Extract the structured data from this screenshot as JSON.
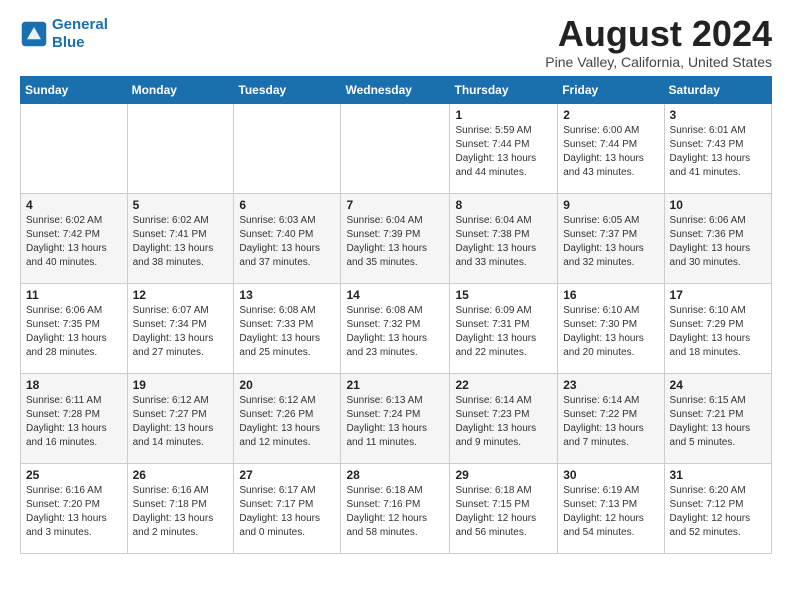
{
  "header": {
    "logo_line1": "General",
    "logo_line2": "Blue",
    "month_year": "August 2024",
    "location": "Pine Valley, California, United States"
  },
  "days_of_week": [
    "Sunday",
    "Monday",
    "Tuesday",
    "Wednesday",
    "Thursday",
    "Friday",
    "Saturday"
  ],
  "weeks": [
    [
      {
        "day": "",
        "info": ""
      },
      {
        "day": "",
        "info": ""
      },
      {
        "day": "",
        "info": ""
      },
      {
        "day": "",
        "info": ""
      },
      {
        "day": "1",
        "info": "Sunrise: 5:59 AM\nSunset: 7:44 PM\nDaylight: 13 hours\nand 44 minutes."
      },
      {
        "day": "2",
        "info": "Sunrise: 6:00 AM\nSunset: 7:44 PM\nDaylight: 13 hours\nand 43 minutes."
      },
      {
        "day": "3",
        "info": "Sunrise: 6:01 AM\nSunset: 7:43 PM\nDaylight: 13 hours\nand 41 minutes."
      }
    ],
    [
      {
        "day": "4",
        "info": "Sunrise: 6:02 AM\nSunset: 7:42 PM\nDaylight: 13 hours\nand 40 minutes."
      },
      {
        "day": "5",
        "info": "Sunrise: 6:02 AM\nSunset: 7:41 PM\nDaylight: 13 hours\nand 38 minutes."
      },
      {
        "day": "6",
        "info": "Sunrise: 6:03 AM\nSunset: 7:40 PM\nDaylight: 13 hours\nand 37 minutes."
      },
      {
        "day": "7",
        "info": "Sunrise: 6:04 AM\nSunset: 7:39 PM\nDaylight: 13 hours\nand 35 minutes."
      },
      {
        "day": "8",
        "info": "Sunrise: 6:04 AM\nSunset: 7:38 PM\nDaylight: 13 hours\nand 33 minutes."
      },
      {
        "day": "9",
        "info": "Sunrise: 6:05 AM\nSunset: 7:37 PM\nDaylight: 13 hours\nand 32 minutes."
      },
      {
        "day": "10",
        "info": "Sunrise: 6:06 AM\nSunset: 7:36 PM\nDaylight: 13 hours\nand 30 minutes."
      }
    ],
    [
      {
        "day": "11",
        "info": "Sunrise: 6:06 AM\nSunset: 7:35 PM\nDaylight: 13 hours\nand 28 minutes."
      },
      {
        "day": "12",
        "info": "Sunrise: 6:07 AM\nSunset: 7:34 PM\nDaylight: 13 hours\nand 27 minutes."
      },
      {
        "day": "13",
        "info": "Sunrise: 6:08 AM\nSunset: 7:33 PM\nDaylight: 13 hours\nand 25 minutes."
      },
      {
        "day": "14",
        "info": "Sunrise: 6:08 AM\nSunset: 7:32 PM\nDaylight: 13 hours\nand 23 minutes."
      },
      {
        "day": "15",
        "info": "Sunrise: 6:09 AM\nSunset: 7:31 PM\nDaylight: 13 hours\nand 22 minutes."
      },
      {
        "day": "16",
        "info": "Sunrise: 6:10 AM\nSunset: 7:30 PM\nDaylight: 13 hours\nand 20 minutes."
      },
      {
        "day": "17",
        "info": "Sunrise: 6:10 AM\nSunset: 7:29 PM\nDaylight: 13 hours\nand 18 minutes."
      }
    ],
    [
      {
        "day": "18",
        "info": "Sunrise: 6:11 AM\nSunset: 7:28 PM\nDaylight: 13 hours\nand 16 minutes."
      },
      {
        "day": "19",
        "info": "Sunrise: 6:12 AM\nSunset: 7:27 PM\nDaylight: 13 hours\nand 14 minutes."
      },
      {
        "day": "20",
        "info": "Sunrise: 6:12 AM\nSunset: 7:26 PM\nDaylight: 13 hours\nand 12 minutes."
      },
      {
        "day": "21",
        "info": "Sunrise: 6:13 AM\nSunset: 7:24 PM\nDaylight: 13 hours\nand 11 minutes."
      },
      {
        "day": "22",
        "info": "Sunrise: 6:14 AM\nSunset: 7:23 PM\nDaylight: 13 hours\nand 9 minutes."
      },
      {
        "day": "23",
        "info": "Sunrise: 6:14 AM\nSunset: 7:22 PM\nDaylight: 13 hours\nand 7 minutes."
      },
      {
        "day": "24",
        "info": "Sunrise: 6:15 AM\nSunset: 7:21 PM\nDaylight: 13 hours\nand 5 minutes."
      }
    ],
    [
      {
        "day": "25",
        "info": "Sunrise: 6:16 AM\nSunset: 7:20 PM\nDaylight: 13 hours\nand 3 minutes."
      },
      {
        "day": "26",
        "info": "Sunrise: 6:16 AM\nSunset: 7:18 PM\nDaylight: 13 hours\nand 2 minutes."
      },
      {
        "day": "27",
        "info": "Sunrise: 6:17 AM\nSunset: 7:17 PM\nDaylight: 13 hours\nand 0 minutes."
      },
      {
        "day": "28",
        "info": "Sunrise: 6:18 AM\nSunset: 7:16 PM\nDaylight: 12 hours\nand 58 minutes."
      },
      {
        "day": "29",
        "info": "Sunrise: 6:18 AM\nSunset: 7:15 PM\nDaylight: 12 hours\nand 56 minutes."
      },
      {
        "day": "30",
        "info": "Sunrise: 6:19 AM\nSunset: 7:13 PM\nDaylight: 12 hours\nand 54 minutes."
      },
      {
        "day": "31",
        "info": "Sunrise: 6:20 AM\nSunset: 7:12 PM\nDaylight: 12 hours\nand 52 minutes."
      }
    ]
  ]
}
